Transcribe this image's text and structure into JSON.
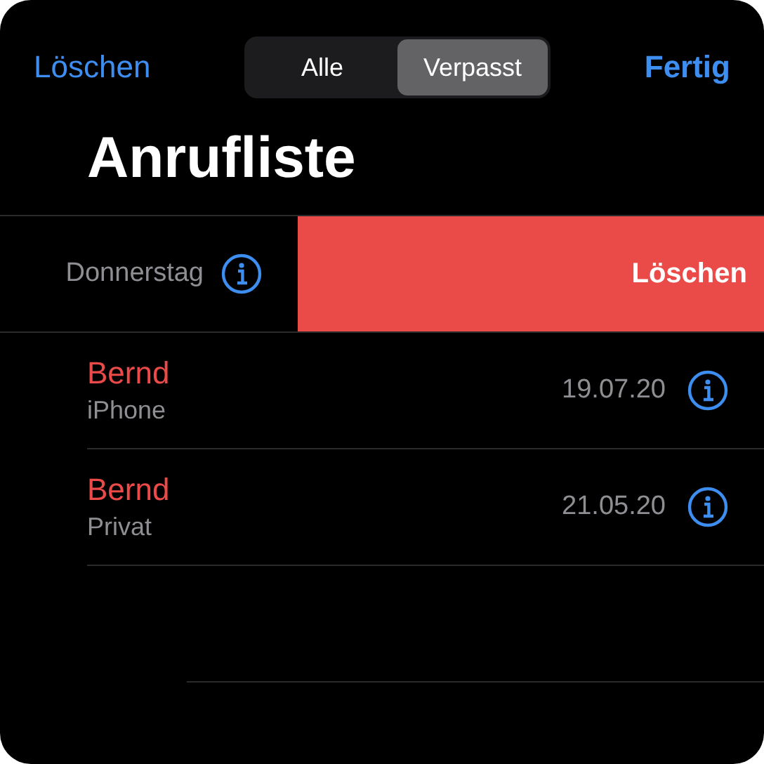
{
  "nav": {
    "left_button": "Löschen",
    "segments": [
      {
        "label": "Alle",
        "selected": false
      },
      {
        "label": "Verpasst",
        "selected": true
      }
    ],
    "right_button": "Fertig"
  },
  "title": "Anrufliste",
  "swiped_row": {
    "date": "Donnerstag",
    "action": "Löschen"
  },
  "calls": [
    {
      "name": "Bernd",
      "type": "iPhone",
      "date": "19.07.20",
      "missed": true
    },
    {
      "name": "Bernd",
      "type": "Privat",
      "date": "21.05.20",
      "missed": true
    }
  ]
}
